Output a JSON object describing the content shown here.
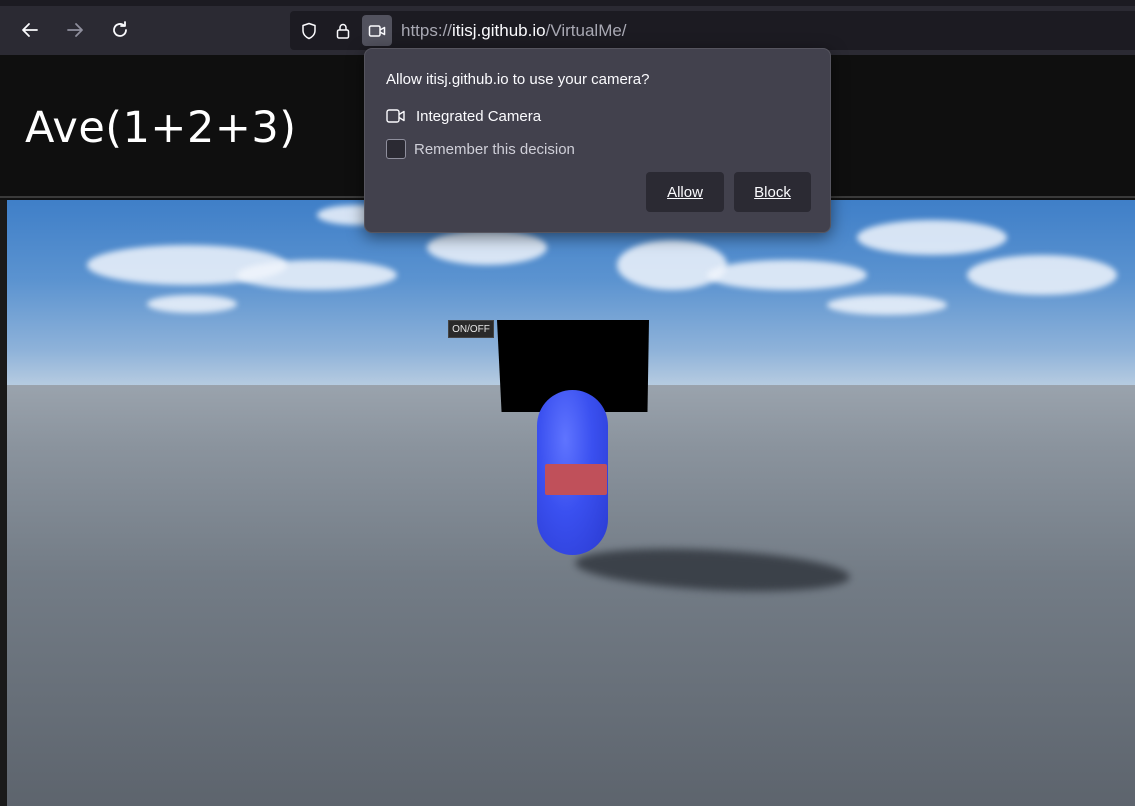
{
  "browser": {
    "url_scheme": "https://",
    "url_host": "itisj.github.io",
    "url_path": "/VirtualMe/"
  },
  "page": {
    "title": "Ave(1+2+3)"
  },
  "scene": {
    "onoff_label": "ON/OFF"
  },
  "permission_popup": {
    "question": "Allow itisj.github.io to use your camera?",
    "device_name": "Integrated Camera",
    "remember_label": "Remember this decision",
    "remember_checked": false,
    "allow_label": "Allow",
    "block_label": "Block"
  }
}
